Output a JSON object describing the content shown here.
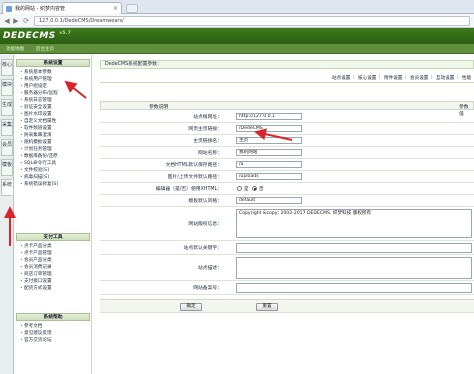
{
  "browser": {
    "tab_title": "我的网站 - 织梦内容管",
    "tab_close": "×",
    "url": "127.0.0.1/DedeCMS/Dreamwears/",
    "back": "◀",
    "forward": "▶",
    "reload": "⟳"
  },
  "header": {
    "logo": "DEDECMS",
    "logo_version": "v5.7",
    "links": [
      "功能地图",
      "后台主页"
    ]
  },
  "rail": [
    "核心",
    "模块",
    "生成",
    "采集",
    "会员",
    "模板",
    "系统"
  ],
  "menu": {
    "groups": [
      {
        "title": "系统设置",
        "items": [
          "系统基本参数",
          "系统用户管理",
          "用户组设定",
          "服务器分布/远程",
          "系统日志管理",
          "验证安全设置",
          "图片水印设置",
          "自定义文档属性",
          "软件频道设置",
          "防采集串混淆",
          "随机模板设置",
          "计划任务管理",
          "数据库备份/还原",
          "SQL命令行工具",
          "文件校验[S]",
          "病毒扫描[S]",
          "系统错误修复[S]"
        ]
      },
      {
        "title": "支付工具",
        "items": [
          "点卡产品分类",
          "点卡产品管理",
          "会员产品分类",
          "会员消费记录",
          "商店订单管理",
          "支付接口设置",
          "配货方式设置"
        ]
      },
      {
        "title": "系统帮助",
        "items": [
          "参考文档",
          "意见建议反馈",
          "官方交流论坛"
        ]
      }
    ]
  },
  "content": {
    "title": "DedeCMS系统配置参数：",
    "tabs": [
      "站点设置",
      "核心设置",
      "附件设置",
      "会员设置",
      "互动设置",
      "性能"
    ],
    "table_header": [
      "参数说明",
      "参数值"
    ],
    "rows": [
      {
        "label": "站点根网址：",
        "value": "http://127.0.0.1"
      },
      {
        "label": "网页主页链接：",
        "value": "/DedeCMS"
      },
      {
        "label": "主页链接名：",
        "value": "主页"
      },
      {
        "label": "网站名称：",
        "value": "我的网站"
      },
      {
        "label": "文档HTML默认保存路径：",
        "value": "/a"
      },
      {
        "label": "图片/上传文件默认路径：",
        "value": "/uploads"
      },
      {
        "label": "编辑器（是/否）使用XHTML：",
        "radio": [
          "是",
          "否"
        ],
        "selected": 1
      },
      {
        "label": "模板默认风格：",
        "value": "default"
      },
      {
        "label": "网站版权信息：",
        "value": "Copyright &copy; 2002-2017 DEDECMS. 织梦科技 版权所有"
      },
      {
        "label": "站点默认关键字：",
        "value": ""
      },
      {
        "label": "站点描述：",
        "value": ""
      },
      {
        "label": "网站备案号：",
        "value": ""
      }
    ],
    "buttons": {
      "confirm": "确定",
      "reset": "重置"
    }
  },
  "colors": {
    "header_green": "#3d7a1c",
    "arrow_red": "#d9262b"
  }
}
